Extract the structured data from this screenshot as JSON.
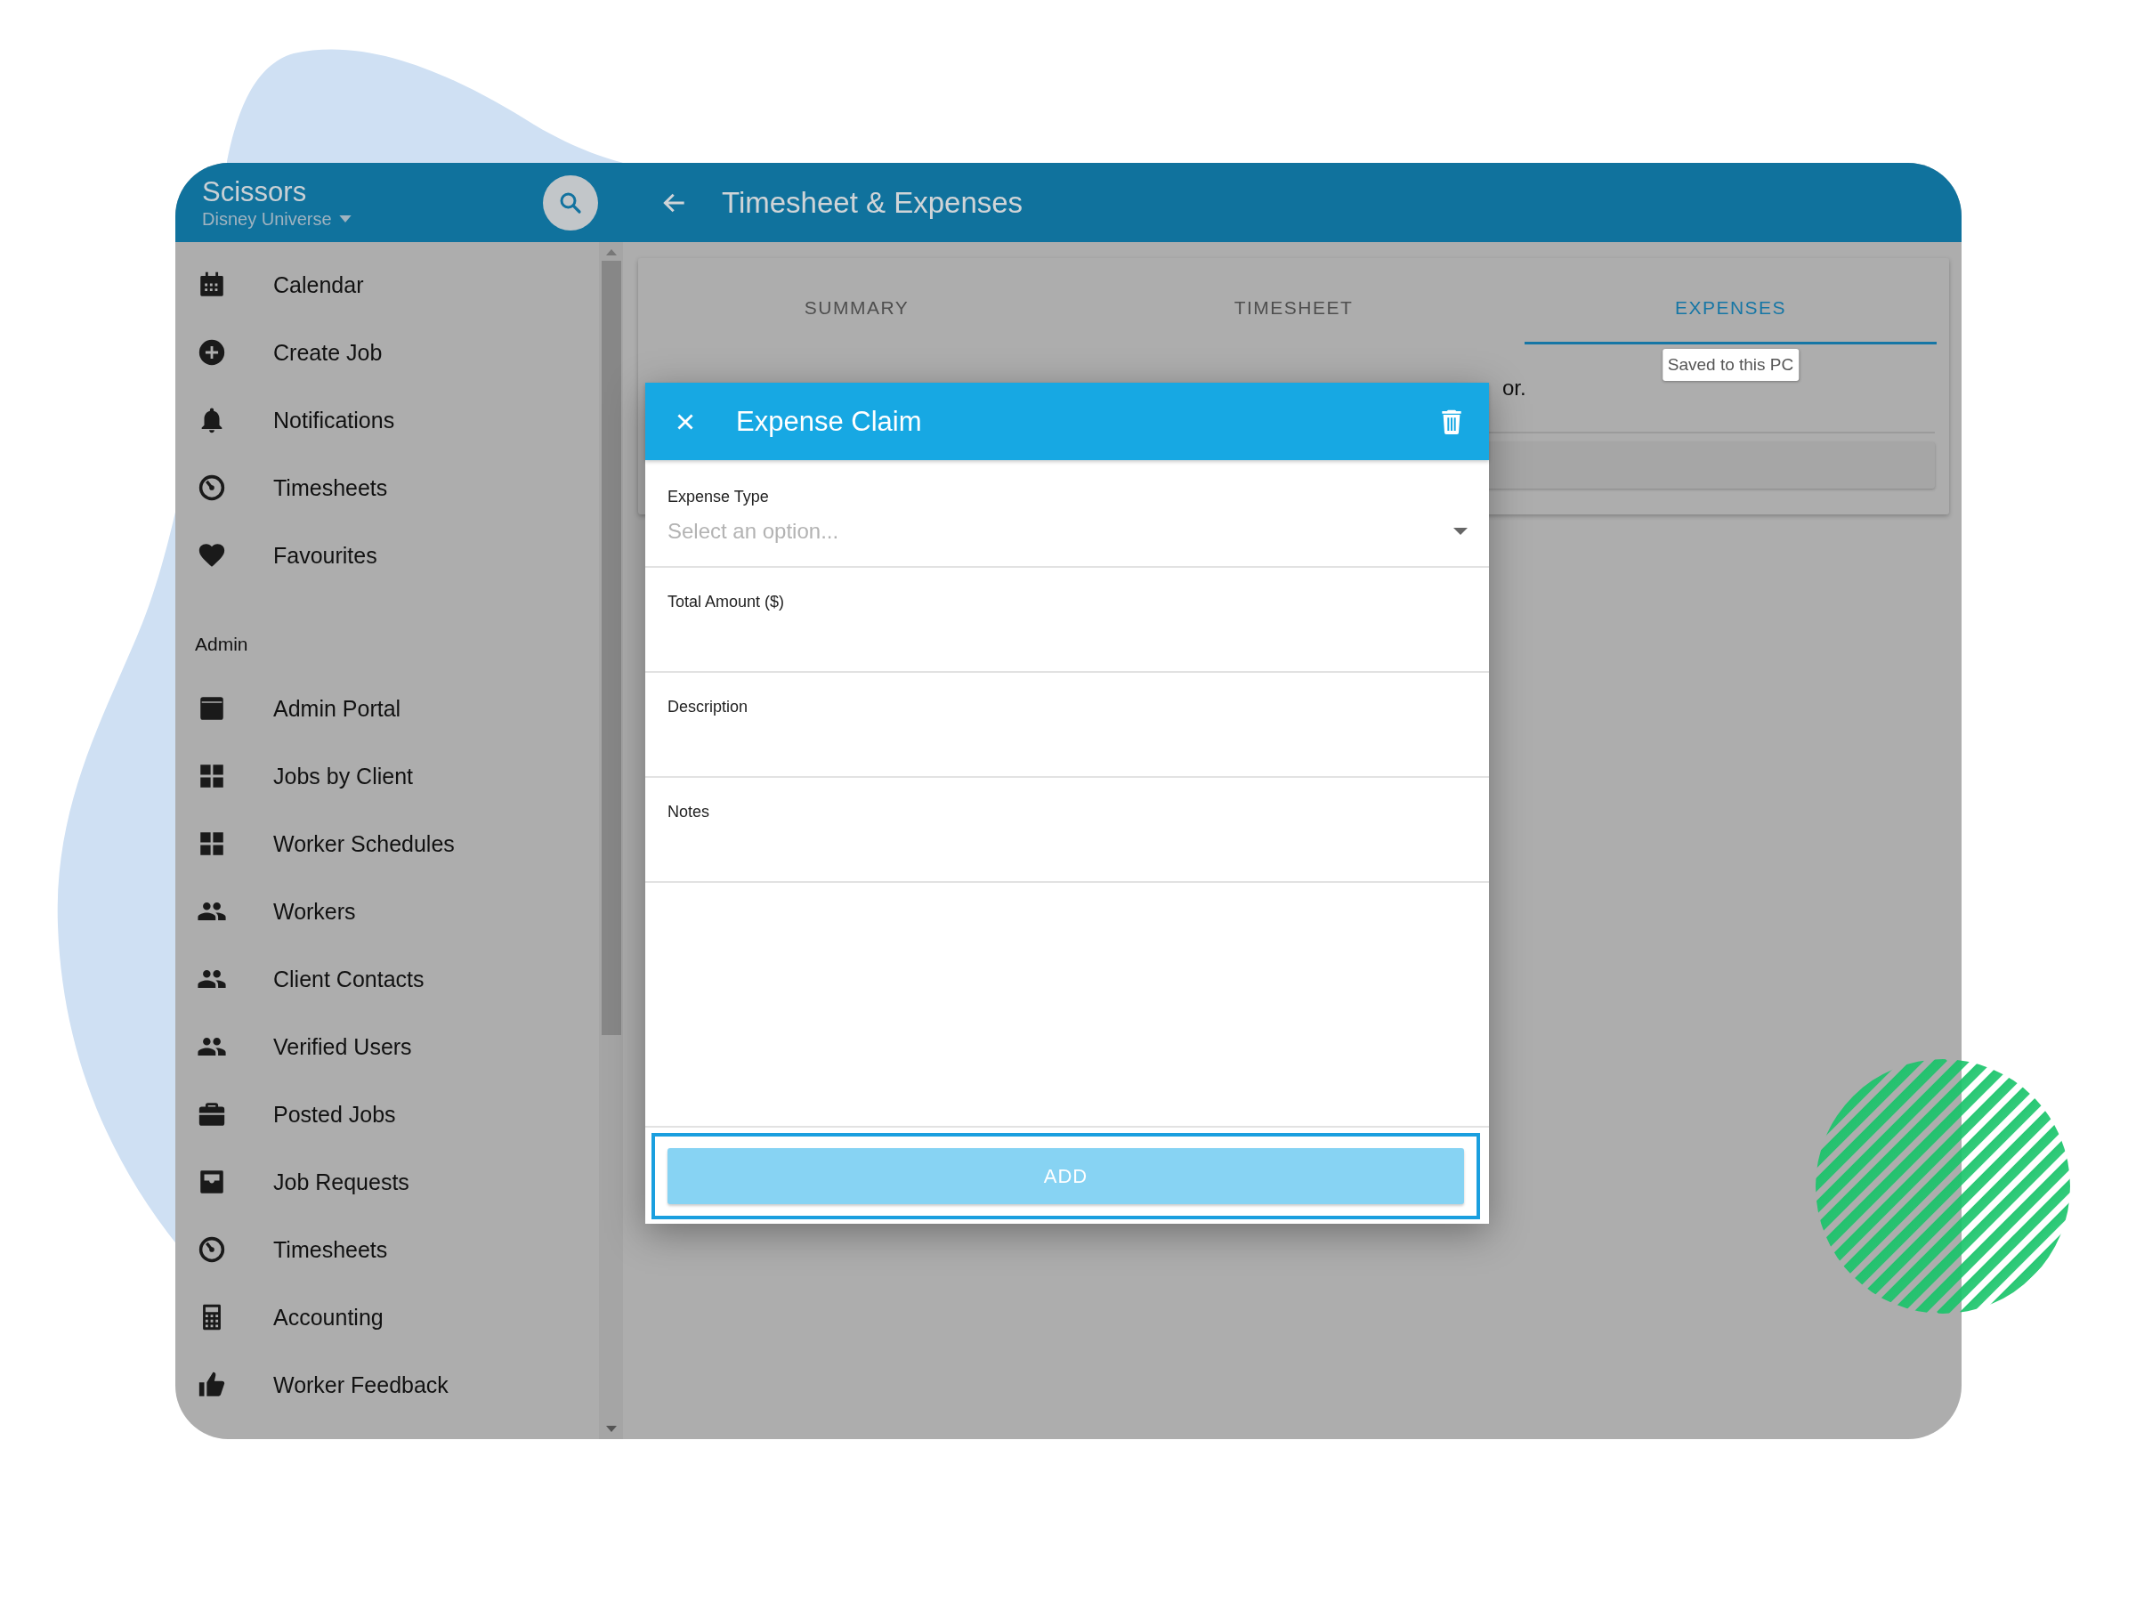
{
  "header": {
    "app_name": "Scissors",
    "org": "Disney Universe",
    "title": "Timesheet & Expenses"
  },
  "sidebar": {
    "items": [
      "Calendar",
      "Create Job",
      "Notifications",
      "Timesheets",
      "Favourites"
    ],
    "section_label": "Admin",
    "admin_items": [
      "Admin Portal",
      "Jobs by Client",
      "Worker Schedules",
      "Workers",
      "Client Contacts",
      "Verified Users",
      "Posted Jobs",
      "Job Requests",
      "Timesheets",
      "Accounting",
      "Worker Feedback"
    ]
  },
  "tabs": [
    {
      "label": "SUMMARY",
      "selected": false
    },
    {
      "label": "TIMESHEET",
      "selected": false
    },
    {
      "label": "EXPENSES",
      "selected": true
    }
  ],
  "tooltip": "Saved to this PC",
  "content_text": "or.",
  "dialog": {
    "title": "Expense Claim",
    "fields": [
      {
        "kind": "select",
        "label": "Expense Type",
        "placeholder": "Select an option..."
      },
      {
        "kind": "text",
        "label": "Total Amount ($)"
      },
      {
        "kind": "text",
        "label": "Description"
      },
      {
        "kind": "text",
        "label": "Notes"
      }
    ],
    "button": {
      "label": "ADD",
      "disabled": true,
      "focused": true
    }
  }
}
